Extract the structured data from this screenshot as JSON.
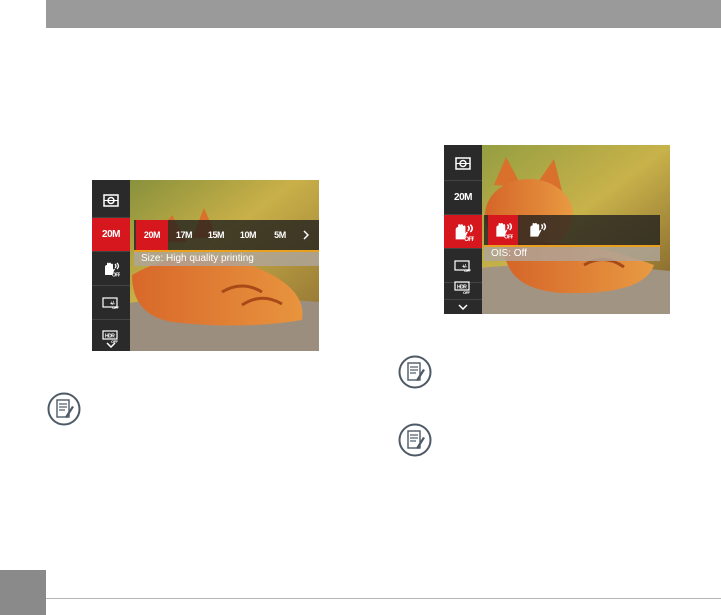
{
  "screen_1": {
    "side_menu": [
      {
        "icon": "metering-icon",
        "label": ""
      },
      {
        "icon": "image-size-icon",
        "label": "20M",
        "active": true
      },
      {
        "icon": "ois-icon",
        "label": ""
      },
      {
        "icon": "exposure-icon",
        "label": ""
      },
      {
        "icon": "hdr-icon",
        "label": ""
      },
      {
        "icon": "chevron-down-icon",
        "label": ""
      }
    ],
    "options": [
      "20M",
      "17M",
      "15M",
      "10M",
      "5M"
    ],
    "selected_option": "20M",
    "more_icon": "chevron-right-icon",
    "info_text": "Size: High quality printing"
  },
  "screen_2": {
    "side_menu": [
      {
        "icon": "metering-icon",
        "label": ""
      },
      {
        "icon": "image-size-icon",
        "label": "20M"
      },
      {
        "icon": "ois-off-icon",
        "label": "",
        "active": true
      },
      {
        "icon": "exposure-icon",
        "label": ""
      },
      {
        "icon": "hdr-icon",
        "label": ""
      },
      {
        "icon": "chevron-down-icon",
        "label": ""
      }
    ],
    "options": [
      "ois-off-icon",
      "ois-on-icon"
    ],
    "info_text": "OIS: Off"
  },
  "notes": [
    "note-icon",
    "note-icon",
    "note-icon"
  ],
  "colors": {
    "accent_red": "#d6171e",
    "header_gray": "#9a9a9a",
    "highlight_orange": "#e8a020"
  }
}
